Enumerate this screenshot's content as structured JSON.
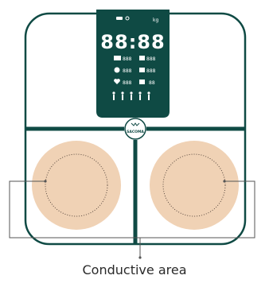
{
  "colors": {
    "scale_outline": "#0f4a44",
    "display_fill": "#0f4a44",
    "display_text": "#ffffff",
    "pad_fill": "#f0d2b5",
    "leader_line": "#555555"
  },
  "display": {
    "unit_label": "kg",
    "main_readout": "88:88",
    "metric_rows": [
      [
        {
          "icon": "body-fat-icon",
          "value": "888"
        },
        {
          "icon": "bmi-icon",
          "value": "888"
        }
      ],
      [
        {
          "icon": "muscle-icon",
          "value": "888"
        },
        {
          "icon": "water-icon",
          "value": "888"
        }
      ],
      [
        {
          "icon": "heart-icon",
          "value": "888"
        },
        {
          "icon": "bone-icon",
          "value": "88"
        }
      ]
    ],
    "user_icons": [
      "person-icon",
      "person-icon",
      "person-icon",
      "person-icon",
      "person-icon"
    ]
  },
  "brand": {
    "logo_text": "SACOMA"
  },
  "callout": {
    "label": "Conductive area"
  }
}
